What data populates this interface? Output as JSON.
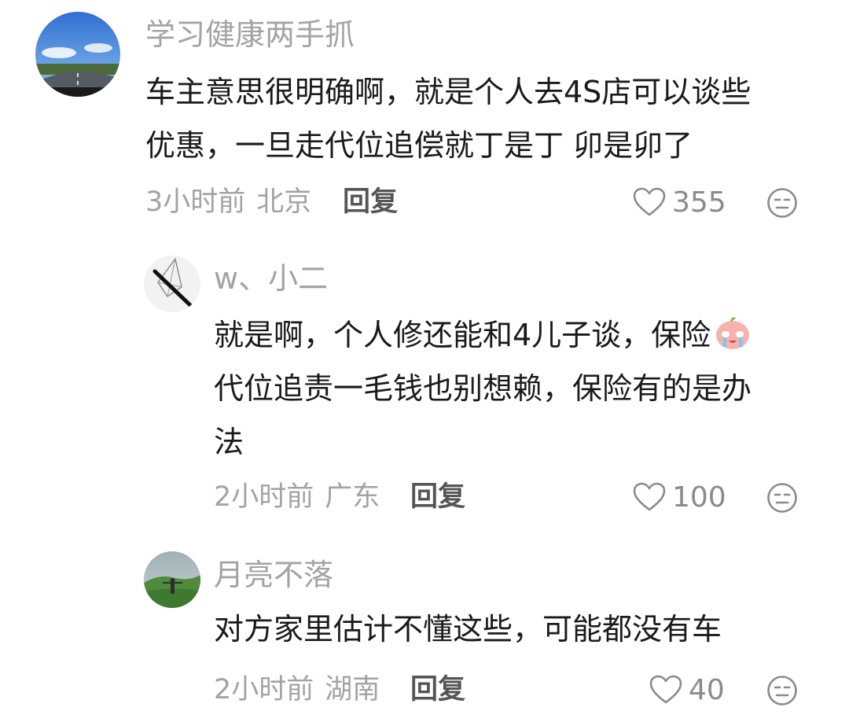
{
  "comments": [
    {
      "username": "学习健康两手抓",
      "avatar_icon": "avatar-road-photo",
      "lines": [
        "车主意思很明确啊，就是个人去4S店可以谈些",
        "优惠，一旦走代位追偿就丁是丁 卯是卯了"
      ],
      "time": "3小时前",
      "location": "北京",
      "reply_label": "回复",
      "likes": "355"
    },
    {
      "username": "w、小二",
      "avatar_icon": "avatar-sketch",
      "lines": [
        "就是啊，个人修还能和4儿子谈，保险",
        "代位追责一毛钱也别想赖，保险有的是办",
        "法"
      ],
      "inline_emoji": "crying-emoji",
      "time": "2小时前",
      "location": "广东",
      "reply_label": "回复",
      "likes": "100"
    },
    {
      "username": "月亮不落",
      "avatar_icon": "avatar-hill-photo",
      "lines": [
        "对方家里估计不懂这些，可能都没有车"
      ],
      "time": "2小时前",
      "location": "湖南",
      "reply_label": "回复",
      "likes": "40"
    }
  ],
  "icons": {
    "like": "heart-outline-icon",
    "dislike": "dislike-face-icon"
  },
  "colors": {
    "meta_text": "#a3a3a3",
    "body_text": "#1a1a1a",
    "reply_text": "#555555"
  }
}
